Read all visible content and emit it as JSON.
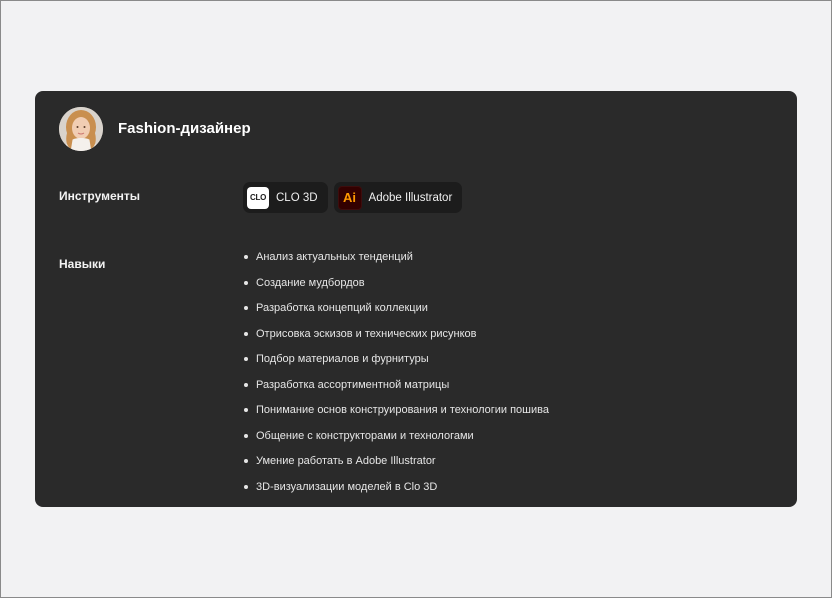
{
  "profile": {
    "title": "Fashion-дизайнер"
  },
  "tools": {
    "label": "Инструменты",
    "items": [
      {
        "icon": "clo-3d-icon",
        "icon_text": "CLO",
        "label": "CLO 3D"
      },
      {
        "icon": "adobe-illustrator-icon",
        "icon_text": "Ai",
        "label": "Adobe Illustrator"
      }
    ]
  },
  "skills": {
    "label": "Навыки",
    "items": [
      "Анализ актуальных тенденций",
      "Создание мудбордов",
      "Разработка концепций коллекции",
      "Отрисовка эскизов и технических рисунков",
      "Подбор материалов и фурнитуры",
      "Разработка ассортиментной матрицы",
      "Понимание основ конструирования и технологии пошива",
      "Общение с конструкторами и технологами",
      "Умение работать в Adobe Illustrator",
      "3D-визуализации моделей в Clo 3D"
    ]
  },
  "colors": {
    "page_bg": "#f2f2f3",
    "card_bg": "#2a2a2a",
    "chip_bg": "#1c1c1c",
    "ai_accent": "#ff9a00"
  }
}
